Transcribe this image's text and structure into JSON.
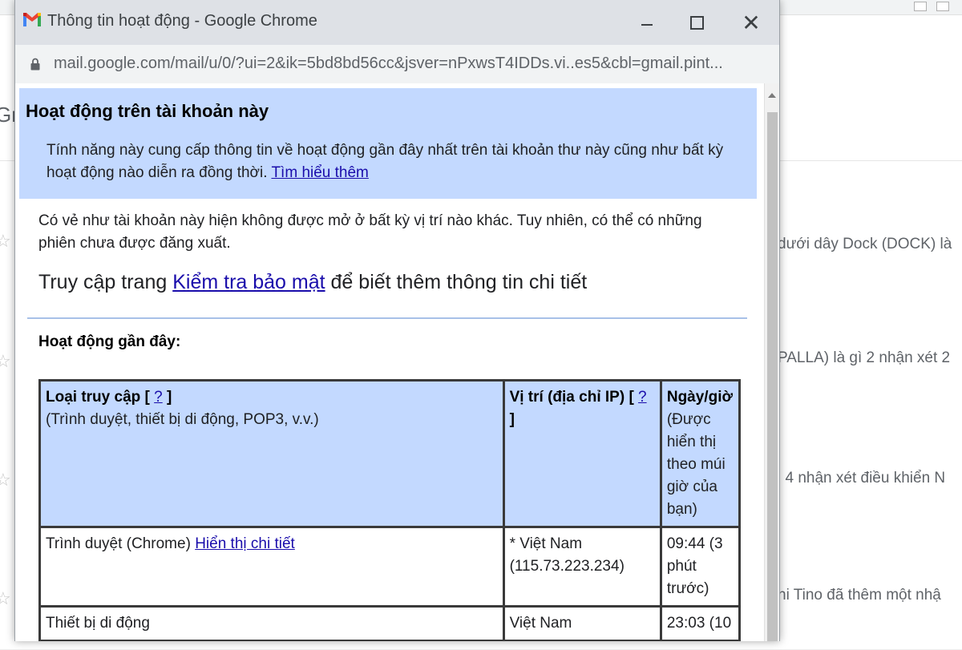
{
  "background": {
    "tab_partial": "Gr",
    "snippets": [
      "dưới dây Dock (DOCK) là",
      "PALLA) là gì 2 nhận xét 2",
      "i 4 nhận xét điều khiển N",
      "hi Tino đã thêm một nhậ"
    ]
  },
  "window": {
    "title": "Thông tin hoạt động - Google Chrome",
    "url": "mail.google.com/mail/u/0/?ui=2&ik=5bd8bd56cc&jsver=nPxwsT4IDDs.vi..es5&cbl=gmail.pint...",
    "controls": {
      "minimize": "minimize",
      "maximize": "maximize",
      "close": "✕"
    }
  },
  "header": {
    "title": "Hoạt động trên tài khoản này",
    "description": "Tính năng này cung cấp thông tin về hoạt động gần đây nhất trên tài khoản thư này cũng như bất kỳ hoạt động nào diễn ra đồng thời.",
    "learn_more": "Tìm hiểu thêm"
  },
  "body": {
    "status_text": "Có vẻ như tài khoản này hiện không được mở ở bất kỳ vị trí nào khác. Tuy nhiên, có thể có những phiên chưa được đăng xuất.",
    "security_prefix": "Truy cập trang",
    "security_link": "Kiểm tra bảo mật",
    "security_suffix": "để biết thêm thông tin chi tiết",
    "recent_label": "Hoạt động gần đây:"
  },
  "table": {
    "headers": {
      "access_type": "Loại truy cập",
      "access_help": "?",
      "access_sub": "(Trình duyệt, thiết bị di động, POP3, v.v.)",
      "location": "Vị trí (địa chỉ IP)",
      "location_help": "?",
      "datetime": "Ngày/giờ",
      "datetime_sub": "(Được hiển thị theo múi giờ của bạn)"
    },
    "rows": [
      {
        "access": "Trình duyệt (Chrome)",
        "details_link": "Hiển thị chi tiết",
        "location": "* Việt Nam (115.73.223.234)",
        "time": "09:44 (3 phút trước)"
      },
      {
        "access": "Thiết bị di động",
        "location": "Việt Nam",
        "time": "23:03 (10"
      }
    ]
  },
  "colors": {
    "header_blue": "#c3d9ff",
    "link": "#1a0dab",
    "titlebar": "#dee1e6"
  }
}
